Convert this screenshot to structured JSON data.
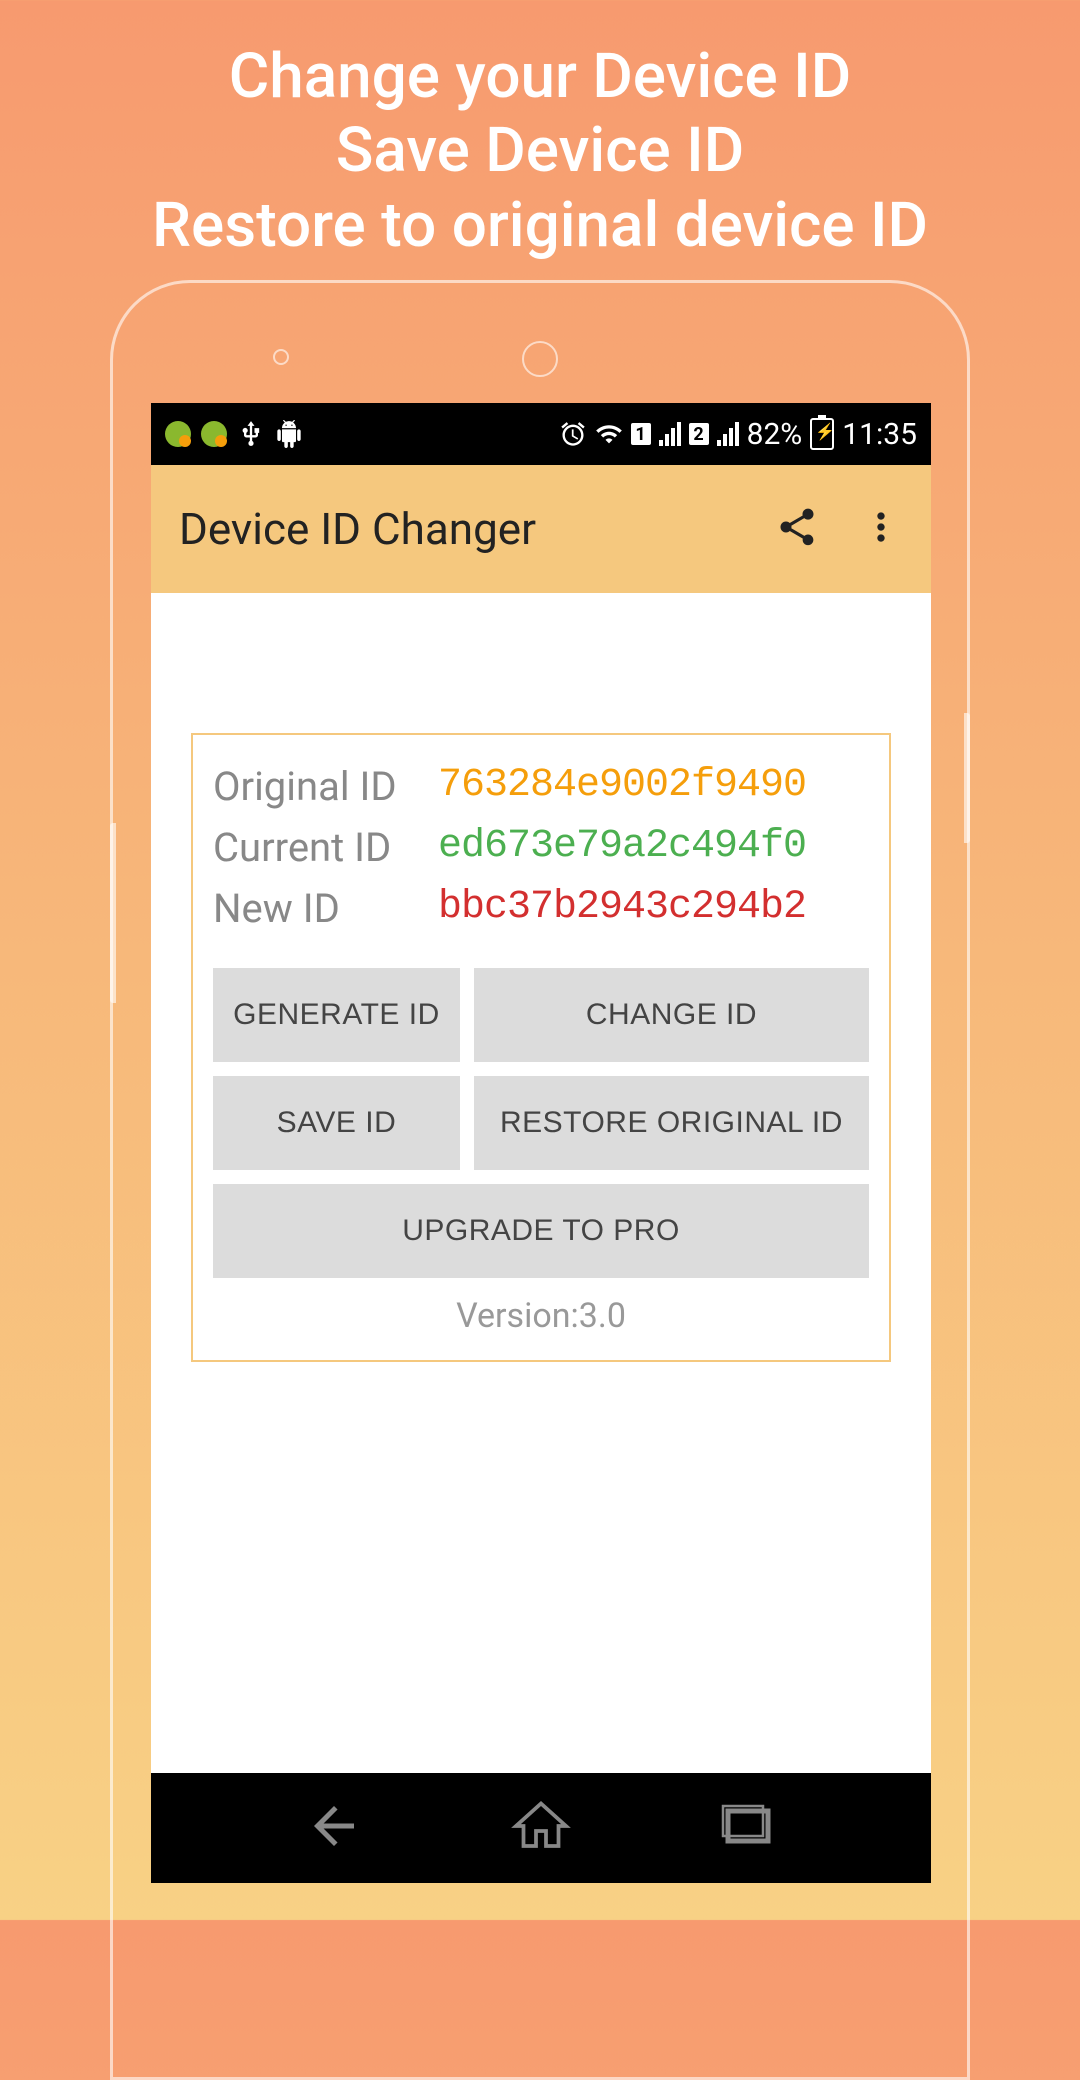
{
  "promo": {
    "line1": "Change your Device ID",
    "line2": "Save Device ID",
    "line3": "Restore to original device ID"
  },
  "statusBar": {
    "battery": "82%",
    "time": "11:35",
    "sim1": "1",
    "sim2": "2"
  },
  "appBar": {
    "title": "Device ID Changer"
  },
  "ids": {
    "originalLabel": "Original ID",
    "originalValue": "763284e9002f9490",
    "currentLabel": "Current ID",
    "currentValue": "ed673e79a2c494f0",
    "newLabel": "New ID",
    "newValue": "bbc37b2943c294b2"
  },
  "buttons": {
    "generate": "GENERATE ID",
    "change": "CHANGE ID",
    "save": "SAVE ID",
    "restore": "RESTORE ORIGINAL ID",
    "upgrade": "UPGRADE TO PRO"
  },
  "version": "Version:3.0"
}
